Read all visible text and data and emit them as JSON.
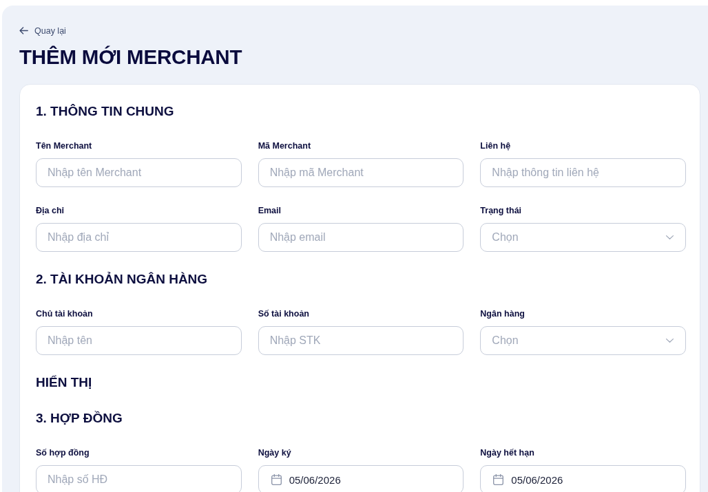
{
  "back_link": {
    "label": "Quay lại"
  },
  "page_title": "THÊM MỚI MERCHANT",
  "sections": [
    {
      "title": "1. THÔNG TIN CHUNG",
      "fields": [
        {
          "kind": "text",
          "label": "Tên Merchant",
          "placeholder": "Nhập tên Merchant"
        },
        {
          "kind": "text",
          "label": "Mã Merchant",
          "placeholder": "Nhập mã Merchant"
        },
        {
          "kind": "text",
          "label": "Liên hệ",
          "placeholder": "Nhập thông tin liên hệ"
        },
        {
          "kind": "text",
          "label": "Địa chỉ",
          "placeholder": "Nhập địa chỉ"
        },
        {
          "kind": "text",
          "label": "Email",
          "placeholder": "Nhập email"
        },
        {
          "kind": "select",
          "label": "Trạng thái",
          "placeholder": "Chọn"
        }
      ]
    },
    {
      "title": "2. TÀI KHOẢN NGÂN HÀNG",
      "fields": [
        {
          "kind": "text",
          "label": "Chủ tài khoản",
          "placeholder": "Nhập tên"
        },
        {
          "kind": "text",
          "label": "Số tài khoản",
          "placeholder": "Nhập STK"
        },
        {
          "kind": "select",
          "label": "Ngân hàng",
          "placeholder": "Chọn"
        }
      ]
    },
    {
      "title": "HIỂN THỊ"
    },
    {
      "title": "3. HỢP ĐỒNG",
      "fields": [
        {
          "kind": "text",
          "label": "Số hợp đồng",
          "placeholder": "Nhập số HĐ"
        },
        {
          "kind": "date",
          "label": "Ngày ký",
          "value": "05/06/2026"
        },
        {
          "kind": "date",
          "label": "Ngày hết hạn",
          "value": "05/06/2026"
        }
      ]
    }
  ]
}
